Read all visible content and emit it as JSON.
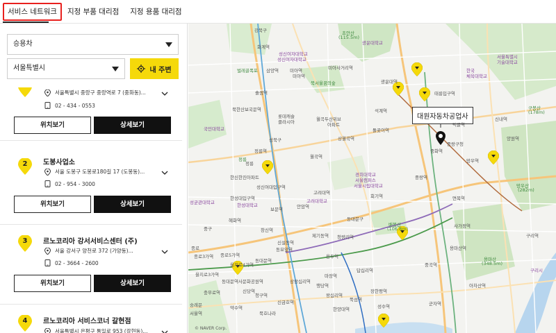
{
  "tabs": [
    {
      "label": "서비스 네트워크",
      "active": true
    },
    {
      "label": "지정 부품 대리점",
      "active": false
    },
    {
      "label": "지정 용품 대리점",
      "active": false
    }
  ],
  "filters": {
    "vehicle_type": "승용차",
    "region": "서울특별시",
    "near_me_label": "내 주변"
  },
  "shops": [
    {
      "num": "",
      "name": "",
      "address": "서울특별시 중랑구 중랑역로 7 (중화동)...",
      "tel": "02 - 434 - 0553",
      "view_label": "위치보기",
      "detail_label": "상세보기"
    },
    {
      "num": "2",
      "name": "도봉사업소",
      "address": "서울 도봉구 도봉로180길 17 (도봉동)...",
      "tel": "02 - 954 - 3000",
      "view_label": "위치보기",
      "detail_label": "상세보기"
    },
    {
      "num": "3",
      "name": "르노코리아 강서서비스센터 (주)",
      "address": "서울 강서구 양천로 372 (가양동)...",
      "tel": "02 - 3664 - 2600",
      "view_label": "위치보기",
      "detail_label": "상세보기"
    },
    {
      "num": "4",
      "name": "르노코리아 서비스코너 갈현점",
      "address": "서울특별시 은평구 통일로 953 (갈현동)...",
      "tel": "",
      "view_label": "",
      "detail_label": ""
    }
  ],
  "map": {
    "callout": "대원자동차공업사",
    "credit": "© NAVER Corp.",
    "labels": {
      "l1": "초안산",
      "l2": "(115.5m)",
      "l3": "강북구",
      "l4": "화계역",
      "l5": "성신여자대학교",
      "l6": "미아사거리역",
      "l7": "서울특별시",
      "l8": "기술대학교",
      "l9": "삼양역",
      "l10": "솔샘역",
      "l11": "미아역",
      "l12": "벌레골폭포",
      "l13": "북서울꿈의숲",
      "l14": "석계역",
      "l15": "광운대역",
      "l16": "한국",
      "l17": "체육대학교",
      "l18": "태릉입구역",
      "l19": "신내역",
      "l20": "구봉산",
      "l21": "(178m)",
      "l22": "국민대학교",
      "l23": "성북구",
      "l24": "롯데캐슬",
      "l25": "클라시아",
      "l26": "월곡두산위브",
      "l27": "아파트",
      "l28": "돌곶이역",
      "l29": "상월곡역",
      "l30": "정릉역",
      "l31": "정릉",
      "l32": "한신한진아파트",
      "l33": "성신여대입구역",
      "l34": "월곡역",
      "l35": "경희대학교",
      "l36": "서울캠퍼스",
      "l37": "회기역",
      "l38": "중랑구청",
      "l39": "중랑역",
      "l40": "망우역",
      "l41": "성균관대학교",
      "l42": "한성대입구역",
      "l43": "보문역",
      "l44": "안암역",
      "l45": "고려대역",
      "l46": "혜화역",
      "l47": "창신역",
      "l48": "신설동역",
      "l49": "동대문구",
      "l50": "배봉산",
      "l51": "(106.8m)",
      "l52": "중구",
      "l53": "종로",
      "l54": "동대문역",
      "l55": "청량리역",
      "l56": "제기동역",
      "l57": "용두역",
      "l58": "왕십리역",
      "l59": "을지로3가역",
      "l60": "동대문역사문화공원역",
      "l61": "상왕십리역",
      "l62": "용마산",
      "l63": "(348.5m)",
      "l64": "구리시",
      "l65": "아차산역",
      "l66": "군자역",
      "l67": "면목역",
      "l68": "사가정역",
      "l69": "용마산역",
      "l70": "중곡역",
      "l71": "광운대학교",
      "l72": "망우산",
      "l73": "(282m)",
      "l74": "신당역",
      "l75": "청구역",
      "l76": "약수역",
      "l77": "한양대역",
      "l78": "성수역",
      "l79": "뚝섬역",
      "l80": "장한평역",
      "l81": "답십리역",
      "l82": "마장역",
      "l83": "신금호역",
      "l84": "행당역",
      "l85": "충무로역",
      "l86": "을지로4가역",
      "l87": "묵호나라",
      "l88": "중화역",
      "l89": "먹골역",
      "l90": "양원역",
      "l91": "구리역",
      "l92": "동묘앞역",
      "l93": "종로3가역",
      "l94": "종로5가역",
      "l95": "서울시립대학교",
      "l96": "성신여자대학교",
      "l97": "미아역",
      "l98": "북한산보국문역",
      "l99": "정릉",
      "l100": "숭례문",
      "l101": "서울역",
      "l102": "한성대학교",
      "l103": "고려대학교"
    }
  }
}
